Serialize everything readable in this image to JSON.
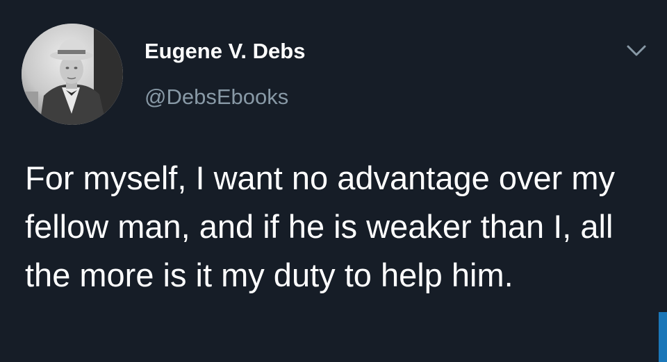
{
  "tweet": {
    "display_name": "Eugene V. Debs",
    "handle": "@DebsEbooks",
    "text": "For myself, I want no advantage over my fellow man, and if he is weaker than I, all the more is it my duty to help him."
  },
  "icons": {
    "avatar": "profile-photo",
    "menu": "chevron-down-icon"
  },
  "colors": {
    "background": "#161d27",
    "primary_text": "#ffffff",
    "secondary_text": "#8899a6",
    "accent": "#1b77b8"
  }
}
